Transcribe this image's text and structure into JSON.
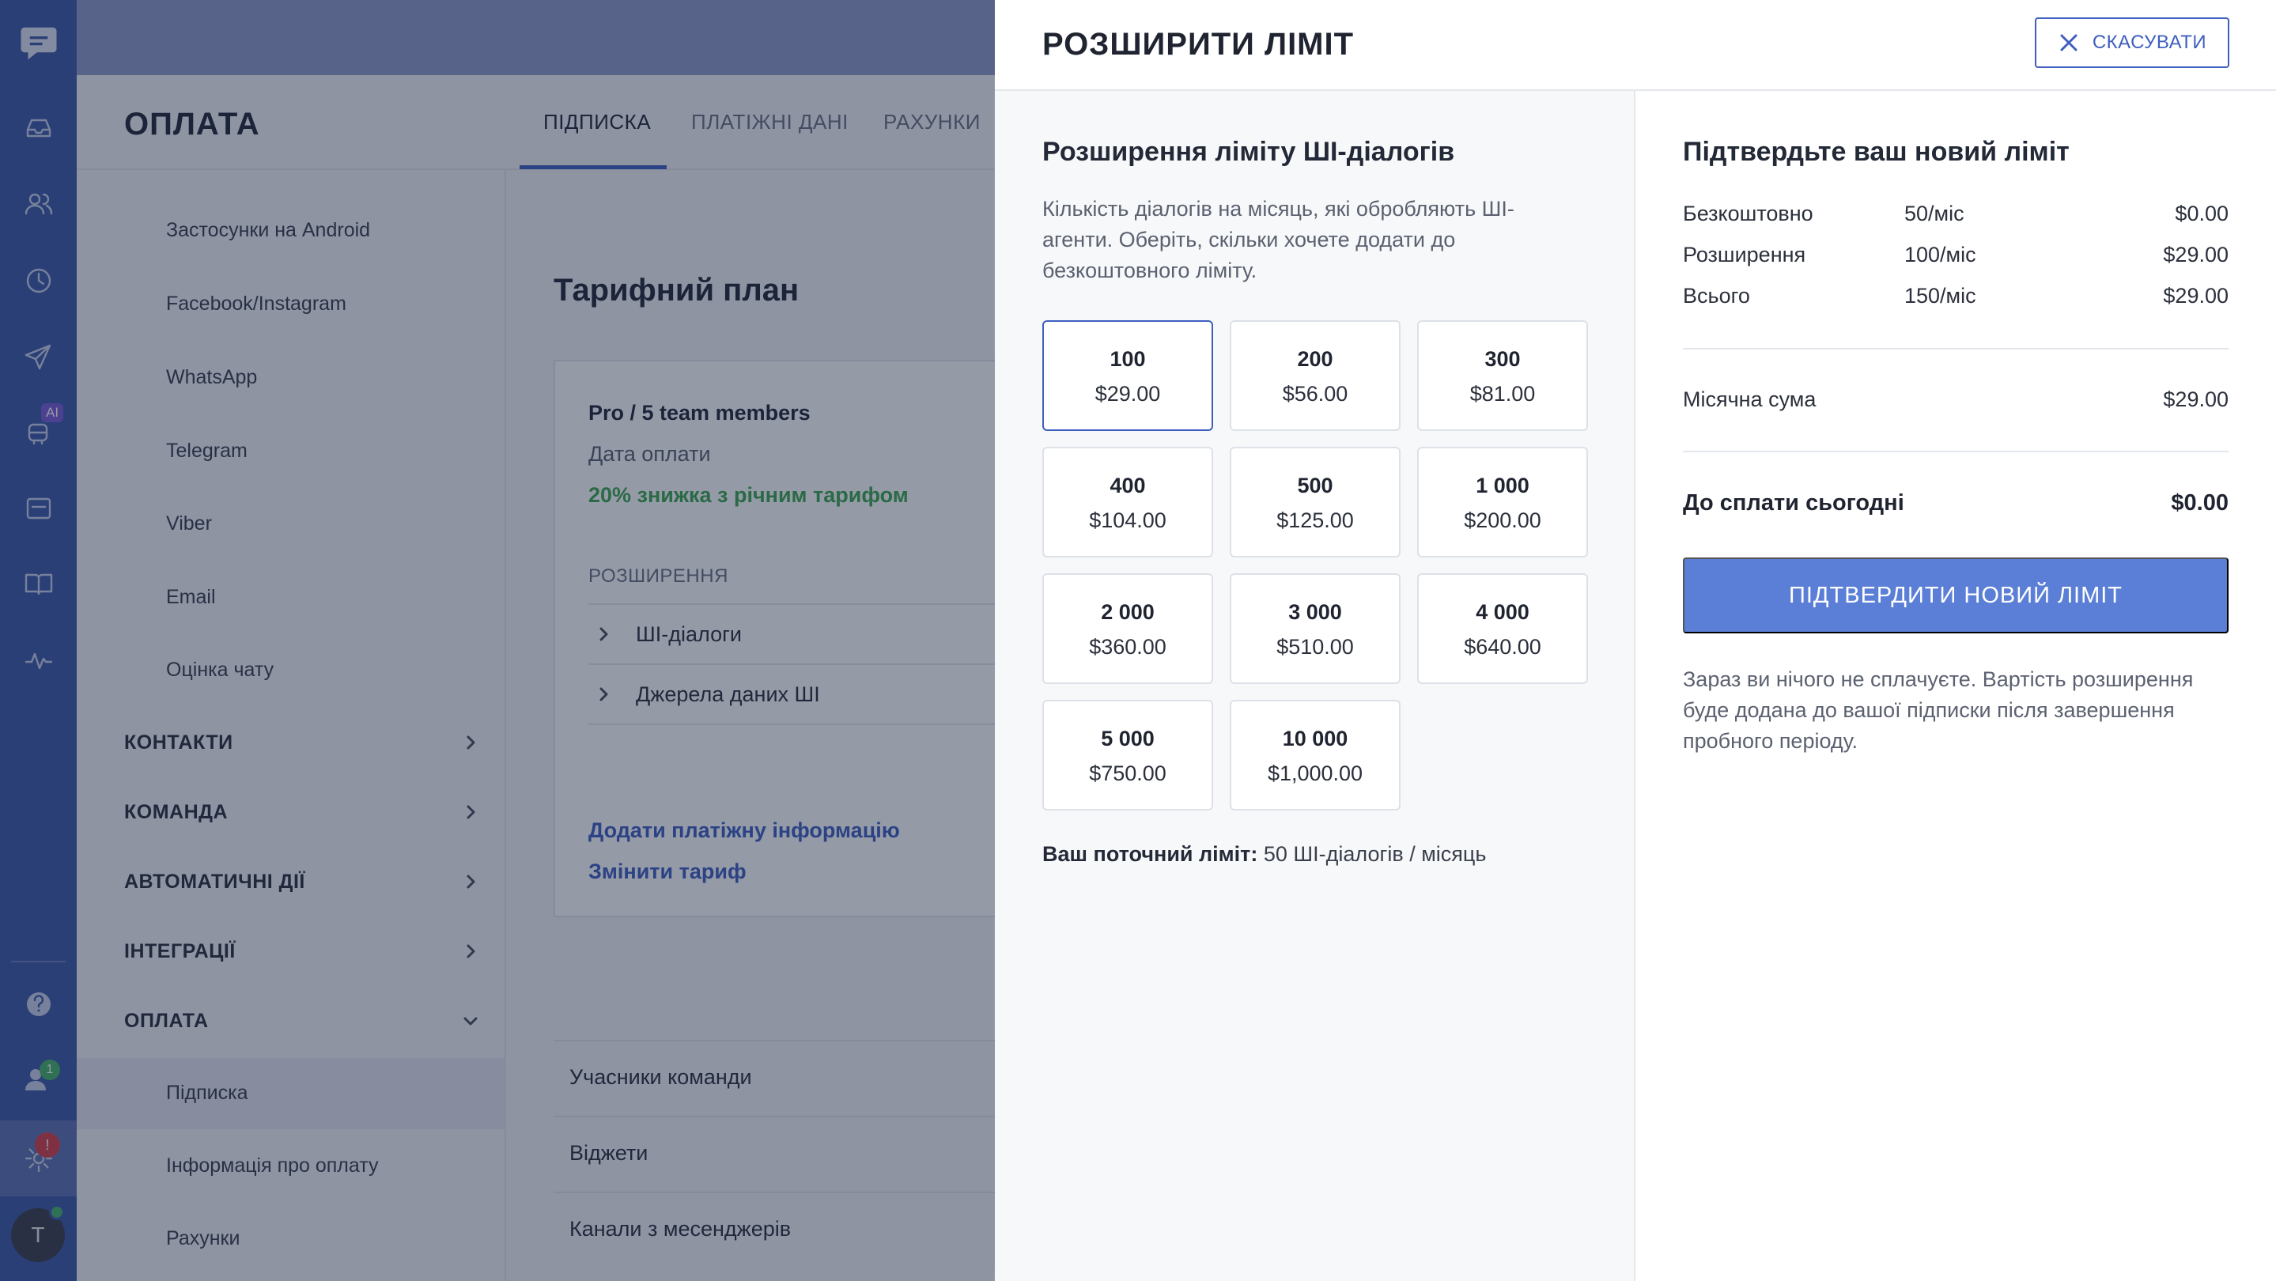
{
  "rail": {
    "icons": [
      "chat-logo-icon",
      "inbox-icon",
      "contacts-icon",
      "history-icon",
      "send-icon",
      "ai-bot-icon",
      "widget-icon",
      "knowledge-book-icon",
      "analytics-icon",
      "help-icon",
      "team-icon",
      "settings-icon"
    ],
    "ai_badge": "AI",
    "team_badge": "1",
    "settings_badge": "!",
    "avatar_letter": "T"
  },
  "page": {
    "title": "ОПЛАТА",
    "tabs": [
      "ПІДПИСКА",
      "ПЛАТІЖНІ ДАНІ",
      "РАХУНКИ"
    ],
    "subnav": {
      "items_top": [
        "Застосунки на Android",
        "Facebook/Instagram",
        "WhatsApp",
        "Telegram",
        "Viber",
        "Email",
        "Оцінка чату"
      ],
      "groups": [
        "КОНТАКТИ",
        "КОМАНДА",
        "АВТОМАТИЧНІ ДІЇ",
        "ІНТЕГРАЦІЇ",
        "ОПЛАТА"
      ],
      "items_bottom": [
        "Підписка",
        "Інформація про оплату",
        "Рахунки"
      ]
    },
    "plan": {
      "heading": "Тарифний план",
      "name": "Pro / 5 team members",
      "date_label": "Дата оплати",
      "discount": "20% знижка з річним тарифом",
      "extensions_label": "РОЗШИРЕННЯ",
      "extensions": [
        "ШІ-діалоги",
        "Джерела даних ШІ"
      ],
      "add_payment_link": "Додати платіжну інформацію",
      "change_plan_link": "Змінити тариф"
    },
    "lower_rows": [
      "Учасники команди",
      "Віджети",
      "Канали з месенджерів"
    ]
  },
  "modal": {
    "title": "РОЗШИРИТИ ЛІМІТ",
    "cancel_label": "СКАСУВАТИ",
    "left": {
      "title": "Розширення ліміту ШІ-діалогів",
      "description": "Кількість діалогів на місяць, які обробляють ШІ-агенти. Оберіть, скільки хочете додати до безкоштовного ліміту.",
      "options": [
        {
          "qty": "100",
          "price": "$29.00",
          "selected": true
        },
        {
          "qty": "200",
          "price": "$56.00"
        },
        {
          "qty": "300",
          "price": "$81.00"
        },
        {
          "qty": "400",
          "price": "$104.00"
        },
        {
          "qty": "500",
          "price": "$125.00"
        },
        {
          "qty": "1 000",
          "price": "$200.00"
        },
        {
          "qty": "2 000",
          "price": "$360.00"
        },
        {
          "qty": "3 000",
          "price": "$510.00"
        },
        {
          "qty": "4 000",
          "price": "$640.00"
        },
        {
          "qty": "5 000",
          "price": "$750.00"
        },
        {
          "qty": "10 000",
          "price": "$1,000.00"
        }
      ],
      "current_limit_label": "Ваш поточний ліміт:",
      "current_limit_value": "50 ШІ-діалогів / місяць"
    },
    "right": {
      "title": "Підтвердьте ваш новий ліміт",
      "rows": [
        {
          "label": "Безкоштовно",
          "qty": "50/міс",
          "price": "$0.00"
        },
        {
          "label": "Розширення",
          "qty": "100/міс",
          "price": "$29.00"
        },
        {
          "label": "Всього",
          "qty": "150/міс",
          "price": "$29.00"
        }
      ],
      "monthly_label": "Місячна сума",
      "monthly_value": "$29.00",
      "today_label": "До сплати сьогодні",
      "today_value": "$0.00",
      "confirm_label": "ПІДТВЕРДИТИ НОВИЙ ЛІМІТ",
      "note": "Зараз ви нічого не сплачуєте. Вартість розширення буде додана до вашої підписки після завершення пробного періоду."
    }
  },
  "colors": {
    "rail": "#3e5aa8",
    "accent": "#3f5fbf",
    "confirm_button": "#5b7fd6",
    "discount_green": "#3ea84f"
  }
}
